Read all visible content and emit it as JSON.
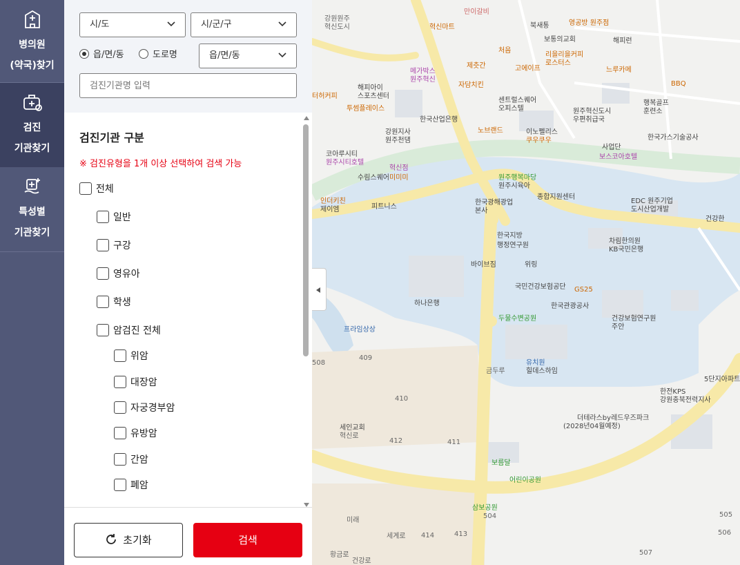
{
  "nav": {
    "items": [
      {
        "label": "병의원\n(약국)찾기"
      },
      {
        "label": "검진\n기관찾기"
      },
      {
        "label": "특성별\n기관찾기"
      }
    ]
  },
  "filters": {
    "sido_label": "시/도",
    "sigungu_label": "시/군/구",
    "radio_eupmyeondong": "읍/면/동",
    "radio_doro": "도로명",
    "eupmyeondong_select": "읍/면/동",
    "name_placeholder": "검진기관명 입력"
  },
  "section": {
    "title": "검진기관 구분",
    "notice": "※ 검진유형을 1개 이상 선택하여 검색 가능"
  },
  "checks": {
    "all": "전체",
    "general": "일반",
    "oral": "구강",
    "infant": "영유아",
    "student": "학생",
    "cancer_all": "암검진 전체",
    "stomach": "위암",
    "colon": "대장암",
    "cervical": "자궁경부암",
    "breast": "유방암",
    "liver": "간암",
    "lung": "폐암"
  },
  "buttons": {
    "reset": "초기화",
    "search": "검색"
  },
  "map": {
    "labels": [
      {
        "text": "강원원주",
        "c": "#666"
      },
      {
        "text": "혁신도시",
        "c": "#666"
      },
      {
        "text": "만이갈비",
        "c": "#c66"
      },
      {
        "text": "북새통",
        "c": "#444"
      },
      {
        "text": "영공방 원주점",
        "c": "#c60"
      },
      {
        "text": "보통의교회",
        "c": "#444"
      },
      {
        "text": "해피런",
        "c": "#444"
      },
      {
        "text": "혁신마트",
        "c": "#c60"
      },
      {
        "text": "처음",
        "c": "#c60"
      },
      {
        "text": "리을리을커피",
        "c": "#c60"
      },
      {
        "text": "로스터스",
        "c": "#c60"
      },
      {
        "text": "고에이프",
        "c": "#c60"
      },
      {
        "text": "느루카메",
        "c": "#c60"
      },
      {
        "text": "제츳간",
        "c": "#c60"
      },
      {
        "text": "메가박스",
        "c": "#a4a"
      },
      {
        "text": "원주혁신",
        "c": "#a4a"
      },
      {
        "text": "해피아이",
        "c": "#444"
      },
      {
        "text": "스포츠센터",
        "c": "#444"
      },
      {
        "text": "자담치킨",
        "c": "#c60"
      },
      {
        "text": "센트럴스퀘어",
        "c": "#444"
      },
      {
        "text": "오피스텔",
        "c": "#444"
      },
      {
        "text": "BBQ",
        "c": "#c60"
      },
      {
        "text": "행복골프",
        "c": "#444"
      },
      {
        "text": "훈련소",
        "c": "#444"
      },
      {
        "text": "터허커피",
        "c": "#c60"
      },
      {
        "text": "투썸플레이스",
        "c": "#c60"
      },
      {
        "text": "한국산업은행",
        "c": "#444"
      },
      {
        "text": "원주혁신도시",
        "c": "#444"
      },
      {
        "text": "우편취급국",
        "c": "#444"
      },
      {
        "text": "노브랜드",
        "c": "#c60"
      },
      {
        "text": "이노펠리스",
        "c": "#444"
      },
      {
        "text": "쿠우쿠우",
        "c": "#c60"
      },
      {
        "text": "한국가스기술공사",
        "c": "#444"
      },
      {
        "text": "강원지사",
        "c": "#444"
      },
      {
        "text": "원주천댐",
        "c": "#444"
      },
      {
        "text": "사업단",
        "c": "#444"
      },
      {
        "text": "보스코아호텔",
        "c": "#a4a"
      },
      {
        "text": "코아루시티",
        "c": "#444"
      },
      {
        "text": "원주시티호텔",
        "c": "#a4a"
      },
      {
        "text": "혁신점",
        "c": "#a4a"
      },
      {
        "text": "미미미",
        "c": "#c60"
      },
      {
        "text": "수림스퀘어",
        "c": "#444"
      },
      {
        "text": "원주행복마당",
        "c": "#393"
      },
      {
        "text": "원주시육아",
        "c": "#444"
      },
      {
        "text": "종합지원센터",
        "c": "#444"
      },
      {
        "text": "EDC 원주기업",
        "c": "#444"
      },
      {
        "text": "도시산업개발",
        "c": "#444"
      },
      {
        "text": "인더키친",
        "c": "#c60"
      },
      {
        "text": "제이엠",
        "c": "#444"
      },
      {
        "text": "피트니스",
        "c": "#444"
      },
      {
        "text": "한국광해광업",
        "c": "#444"
      },
      {
        "text": "본사",
        "c": "#444"
      },
      {
        "text": "건강한",
        "c": "#444"
      },
      {
        "text": "치과의원",
        "c": "#444"
      },
      {
        "text": "한국지방",
        "c": "#444"
      },
      {
        "text": "행정연구원",
        "c": "#444"
      },
      {
        "text": "차림한의원",
        "c": "#444"
      },
      {
        "text": "KB국민은행",
        "c": "#444"
      },
      {
        "text": "바이브짐",
        "c": "#444"
      },
      {
        "text": "위링",
        "c": "#444"
      },
      {
        "text": "국민건강보험공단",
        "c": "#444"
      },
      {
        "text": "GS25",
        "c": "#c60"
      },
      {
        "text": "하나은행",
        "c": "#444"
      },
      {
        "text": "한국관광공사",
        "c": "#444"
      },
      {
        "text": "두물수변공원",
        "c": "#393"
      },
      {
        "text": "건강보험연구원",
        "c": "#444"
      },
      {
        "text": "주안",
        "c": "#444"
      },
      {
        "text": "프라임상상",
        "c": "#36a"
      },
      {
        "text": "유치원",
        "c": "#36a"
      },
      {
        "text": "힐데스하임",
        "c": "#444"
      },
      {
        "text": "5단지아파트",
        "c": "#444"
      },
      {
        "text": "한전KPS",
        "c": "#444"
      },
      {
        "text": "강원충북전력지사",
        "c": "#444"
      },
      {
        "text": "세인교회",
        "c": "#444"
      },
      {
        "text": "혁신로",
        "c": "#666"
      },
      {
        "text": "더테라스by레드우즈파크",
        "c": "#444"
      },
      {
        "text": "(2028년04월예정)",
        "c": "#444"
      },
      {
        "text": "보름달",
        "c": "#393"
      },
      {
        "text": "어린이공원",
        "c": "#393"
      },
      {
        "text": "삼보공원",
        "c": "#393"
      },
      {
        "text": "504",
        "c": "#666"
      },
      {
        "text": "505",
        "c": "#666"
      },
      {
        "text": "506",
        "c": "#666"
      },
      {
        "text": "507",
        "c": "#666"
      },
      {
        "text": "508",
        "c": "#666"
      },
      {
        "text": "409",
        "c": "#666"
      },
      {
        "text": "410",
        "c": "#666"
      },
      {
        "text": "411",
        "c": "#666"
      },
      {
        "text": "412",
        "c": "#666"
      },
      {
        "text": "413",
        "c": "#666"
      },
      {
        "text": "414",
        "c": "#666"
      },
      {
        "text": "건강로",
        "c": "#666"
      },
      {
        "text": "세계로",
        "c": "#666"
      },
      {
        "text": "황금로",
        "c": "#666"
      },
      {
        "text": "미래",
        "c": "#666"
      },
      {
        "text": "금두루",
        "c": "#666"
      }
    ]
  }
}
